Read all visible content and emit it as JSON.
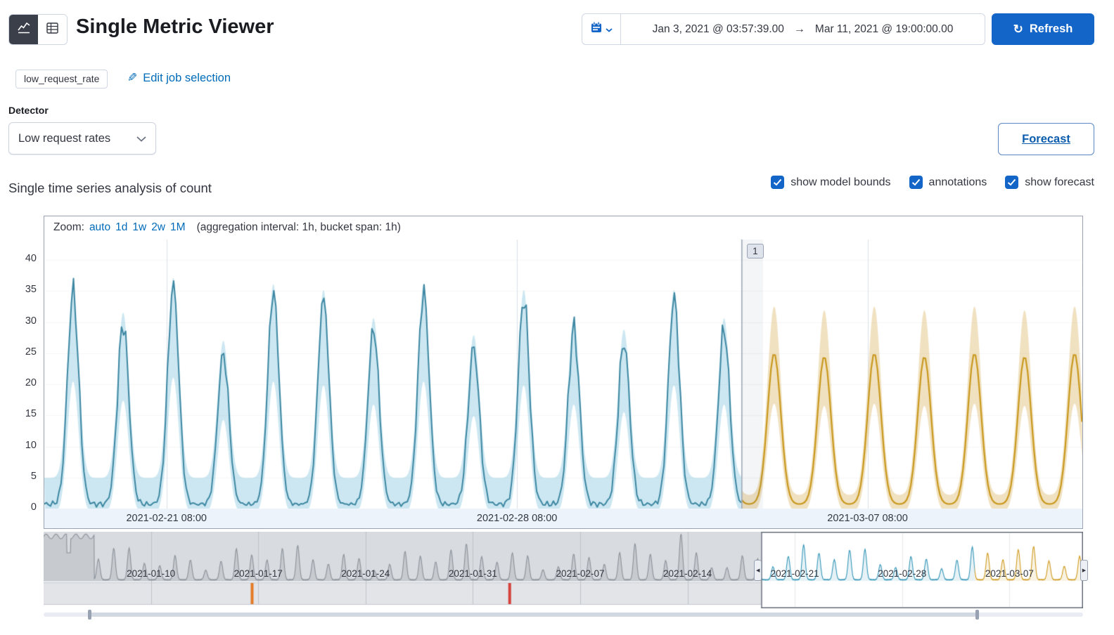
{
  "header": {
    "title": "Single Metric Viewer",
    "time_start": "Jan 3, 2021 @ 03:57:39.00",
    "time_end": "Mar 11, 2021 @ 19:00:00.00",
    "refresh_label": "Refresh"
  },
  "job_bar": {
    "job_badge": "low_request_rate",
    "edit_link": "Edit job selection"
  },
  "detector": {
    "label": "Detector",
    "selected_option": "Low request rates"
  },
  "forecast_button_label": "Forecast",
  "analysis": {
    "title": "Single time series analysis of count",
    "checkboxes": [
      {
        "label": "show model bounds",
        "checked": true
      },
      {
        "label": "annotations",
        "checked": true
      },
      {
        "label": "show forecast",
        "checked": true
      }
    ]
  },
  "zoom": {
    "label": "Zoom:",
    "options": [
      "auto",
      "1d",
      "1w",
      "2w",
      "1M"
    ],
    "aggregation_note": "(aggregation interval: 1h, bucket span: 1h)"
  },
  "chart_data": {
    "type": "line",
    "title": "Single time series analysis of count",
    "main": {
      "ylim": [
        0,
        43.3
      ],
      "yticks": [
        0,
        5,
        10,
        15,
        20,
        25,
        30,
        35,
        40
      ],
      "xticks": [
        {
          "label": "2021-02-21 08:00",
          "day": 2.44
        },
        {
          "label": "2021-02-28 08:00",
          "day": 9.44
        },
        {
          "label": "2021-03-07 08:00",
          "day": 16.44
        }
      ],
      "domain_days": 20.73,
      "forecast_start_day": 13.93,
      "peak_hour_fraction": 0.575,
      "trough": 0.7,
      "actual": {
        "name": "count",
        "color": "#3d87a2",
        "band": "rgba(141,202,223,0.45)",
        "daily_peaks": [
          35,
          30,
          36,
          25,
          35,
          34,
          29,
          35,
          26,
          34,
          29,
          27,
          34,
          29
        ]
      },
      "forecast": {
        "name": "forecast",
        "color": "#c9981d",
        "band": "rgba(226,196,129,0.5)",
        "daily_peaks": [
          25,
          24.5,
          25,
          24.5,
          25,
          24.5,
          25
        ]
      },
      "annotation": {
        "label": "1"
      }
    },
    "context": {
      "domain_days": 67.8,
      "selection_days": [
        46.8,
        67.8
      ],
      "forecast_start_day": 60.73,
      "early_plateau_days": 3.3,
      "ticks": [
        {
          "label": "2021-01-10",
          "day": 7
        },
        {
          "label": "2021-01-17",
          "day": 14
        },
        {
          "label": "2021-01-24",
          "day": 21
        },
        {
          "label": "2021-01-31",
          "day": 28
        },
        {
          "label": "2021-02-07",
          "day": 35
        },
        {
          "label": "2021-02-14",
          "day": 42
        },
        {
          "label": "2021-02-21",
          "day": 49
        },
        {
          "label": "2021-02-28",
          "day": 56
        },
        {
          "label": "2021-03-07",
          "day": 63
        }
      ],
      "anomaly_markers": [
        {
          "day": 13.6,
          "color": "#e57b25",
          "severity": "minor"
        },
        {
          "day": 30.4,
          "color": "#d6413c",
          "severity": "critical"
        }
      ]
    }
  }
}
